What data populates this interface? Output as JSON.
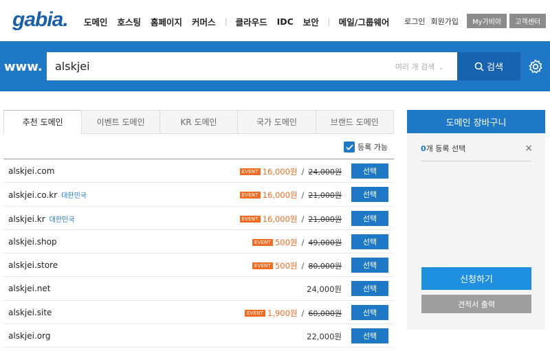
{
  "header": {
    "logo": "gabia.",
    "nav": [
      "도메인",
      "호스팅",
      "홈페이지",
      "커머스",
      "클라우드",
      "IDC",
      "보안",
      "메일/그룹웨어"
    ],
    "login": "로그인",
    "signup": "회원가입",
    "mygabia": "My가비아",
    "support": "고객센터"
  },
  "search": {
    "prefix": "www.",
    "value": "alskjei",
    "multi_label": "여러 개 검색",
    "button": "검색"
  },
  "tabs": [
    "추천 도메인",
    "이벤트 도메인",
    "KR 도메인",
    "국가 도메인",
    "브랜드 도메인"
  ],
  "filter_label": "등록 가능",
  "event_badge": "EVENT",
  "select_label": "선택",
  "slash": "/",
  "domains": [
    {
      "name": "alskjei.com",
      "country": "",
      "event": true,
      "price": "16,000원",
      "original": "24,000원"
    },
    {
      "name": "alskjei.co.kr",
      "country": "대한민국",
      "event": true,
      "price": "16,000원",
      "original": "21,000원"
    },
    {
      "name": "alskjei.kr",
      "country": "대한민국",
      "event": true,
      "price": "16,000원",
      "original": "21,000원"
    },
    {
      "name": "alskjei.shop",
      "country": "",
      "event": true,
      "price": "500원",
      "original": "49,000원"
    },
    {
      "name": "alskjei.store",
      "country": "",
      "event": true,
      "price": "500원",
      "original": "80,000원"
    },
    {
      "name": "alskjei.net",
      "country": "",
      "event": false,
      "price": "24,000원",
      "original": ""
    },
    {
      "name": "alskjei.site",
      "country": "",
      "event": true,
      "price": "1,900원",
      "original": "60,000원"
    },
    {
      "name": "alskjei.org",
      "country": "",
      "event": false,
      "price": "22,000원",
      "original": ""
    }
  ],
  "cart": {
    "title": "도메인 장바구니",
    "count": "0",
    "count_suffix": "개 등록 선택",
    "apply": "신청하기",
    "quote": "견적서 출력"
  },
  "colors": {
    "primary": "#1f78c6",
    "event": "#f26b21",
    "dark_button": "#1863b0"
  }
}
